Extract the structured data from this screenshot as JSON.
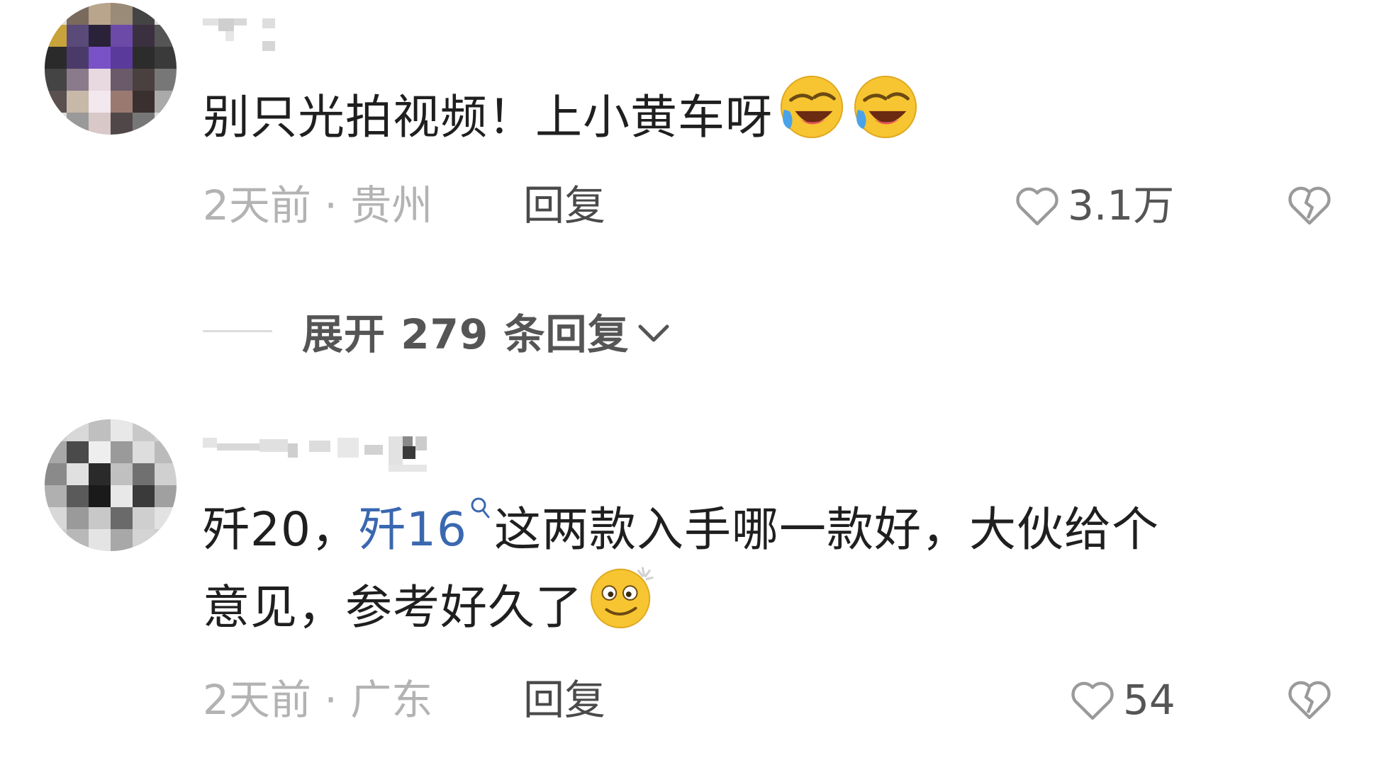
{
  "comments": [
    {
      "username": "",
      "text_parts": [
        "别只光拍视频！上小黄车呀"
      ],
      "emojis": [
        "rofl-emoji",
        "rofl-emoji"
      ],
      "time_location": "2天前 · 贵州",
      "reply_label": "回复",
      "likes": "3.1万",
      "expand_replies": "展开 279 条回复"
    },
    {
      "username": "",
      "text_prefix": "歼20，",
      "link_text": "歼16",
      "line1_rest": "这两款入手哪一款好，大伙给个",
      "line2": "意见，参考好久了",
      "emojis": [
        "dizzy-smile-emoji"
      ],
      "time_location": "2天前 · 广东",
      "reply_label": "回复",
      "likes": "54"
    }
  ],
  "colors": {
    "link": "#3a68b0",
    "meta_gray": "#b3b3b3",
    "icon_gray": "#9a9a9a"
  }
}
